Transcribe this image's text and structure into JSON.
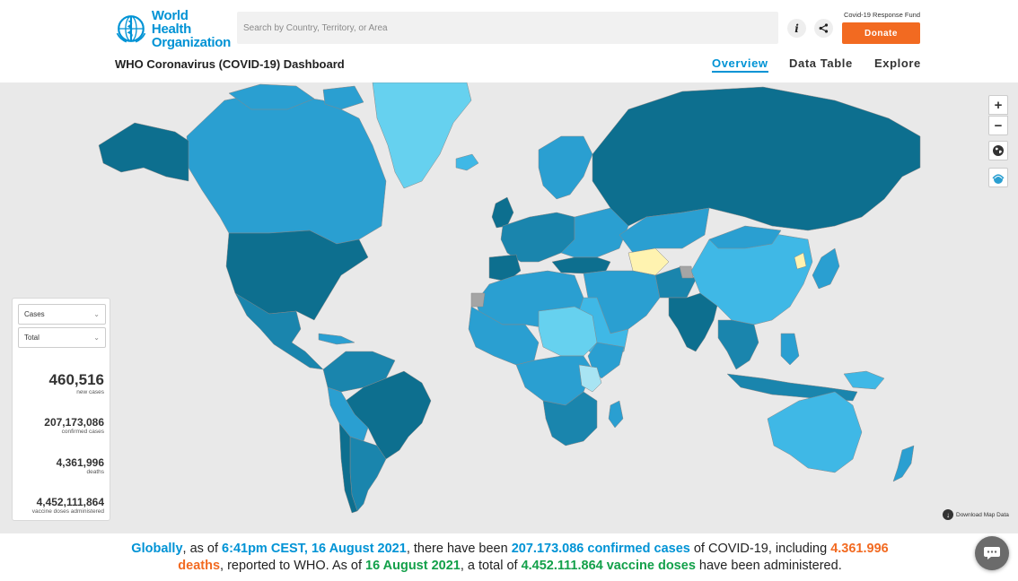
{
  "header": {
    "logo_line1": "World Health",
    "logo_line2": "Organization",
    "search_placeholder": "Search by Country, Territory, or Area",
    "fund_label": "Covid-19 Response Fund",
    "donate_label": "Donate",
    "dashboard_title": "WHO Coronavirus (COVID-19) Dashboard",
    "nav": [
      "Overview",
      "Data Table",
      "Explore"
    ],
    "active_nav": "Overview"
  },
  "map": {
    "download_label": "Download Map Data",
    "colors": {
      "ocean": "#e9e9e9",
      "darkest": "#0d6f8f",
      "dark": "#1a85ad",
      "medium": "#2a9fd1",
      "light": "#3fb8e6",
      "lightest": "#66d1ef",
      "pale": "#a8e4f3",
      "no_data": "#fff3b0",
      "not_applicable": "#a5a5a5"
    }
  },
  "panel": {
    "metric_select": "Cases",
    "period_select": "Total",
    "new_cases": "460,516",
    "new_cases_label": "new cases",
    "confirmed": "207,173,086",
    "confirmed_label": "confirmed cases",
    "deaths": "4,361,996",
    "deaths_label": "deaths",
    "vaccine": "4,452,111,864",
    "vaccine_label": "vaccine doses administered"
  },
  "summary": {
    "p1": "Globally",
    "p2": ", as of ",
    "p3": "6:41pm CEST, 16 August 2021",
    "p4": ", there have been ",
    "p5": "207.173.086 confirmed cases",
    "p6": " of COVID-19, including ",
    "p7": "4.361.996 deaths",
    "p8": ", reported to WHO. As of ",
    "p9": "16 August 2021",
    "p10": ", a total of ",
    "p11": "4.452.111.864 vaccine doses",
    "p12": " have been administered."
  },
  "colors": {
    "brand_blue": "#0093d5",
    "donate_orange": "#f26a21",
    "vaccine_green": "#13a04a"
  }
}
